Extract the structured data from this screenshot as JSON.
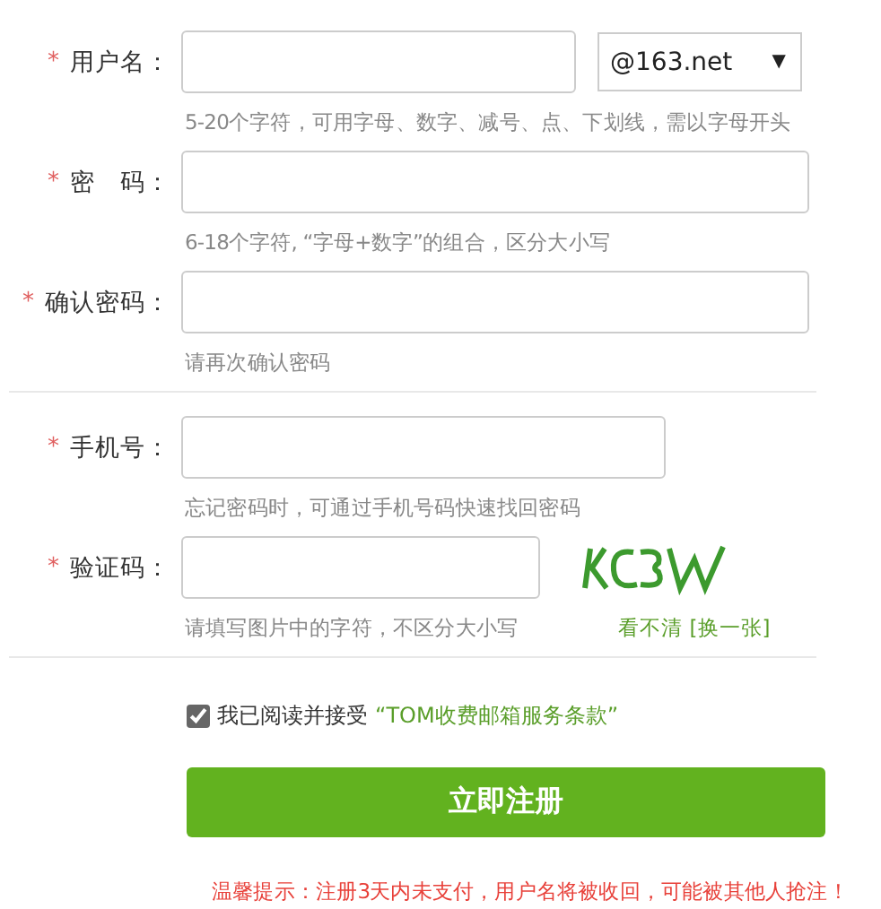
{
  "fields": [
    {
      "kind": "with_select",
      "mark": "*",
      "label": "用户名：",
      "hint": "5-20个字符，可用字母、数字、减号、点、下划线，需以字母开头",
      "domain": {
        "value": "@163.net",
        "arrow": "▼"
      },
      "divider_after": false
    },
    {
      "kind": "wide",
      "mark": "*",
      "label": "密　码：",
      "hint": "6-18个字符, “字母+数字”的组合，区分大小写",
      "divider_after": false
    },
    {
      "kind": "wide",
      "mark": "*",
      "label": "确认密码：",
      "hint": "请再次确认密码",
      "divider_after": true
    },
    {
      "kind": "medium",
      "mark": "*",
      "label": "手机号：",
      "hint": "忘记密码时，可通过手机号码快速找回密码",
      "divider_after": false
    },
    {
      "kind": "with_captcha",
      "mark": "*",
      "label": "验证码：",
      "hint": "请填写图片中的字符，不区分大小写",
      "captcha": {
        "kind": "picture",
        "refresh_link": "看不清 [换一张]"
      },
      "divider_after": true
    }
  ],
  "agreement": {
    "checked": true,
    "text": "我已阅读并接受",
    "link": "“TOM收费邮箱服务条款”"
  },
  "submit_button": "立即注册",
  "notice": "温馨提示：注册3天内未支付，用户名将被收回，可能被其他人抢注！"
}
